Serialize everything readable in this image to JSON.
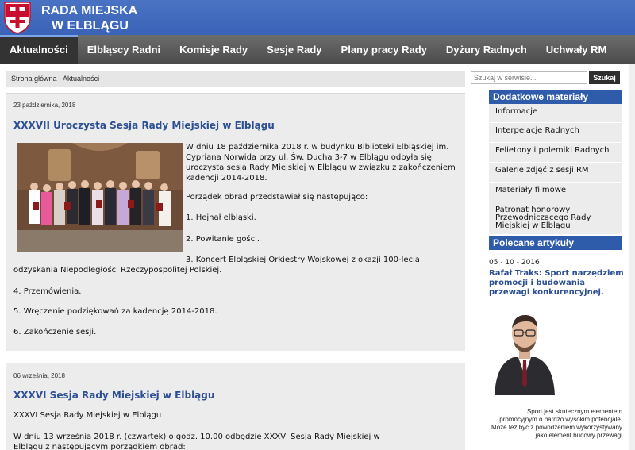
{
  "site": {
    "title_line1": "RADA MIEJSKA",
    "title_line2": "W ELBLĄGU"
  },
  "nav": [
    {
      "label": "Aktualności",
      "active": true
    },
    {
      "label": "Elbląscy Radni"
    },
    {
      "label": "Komisje Rady"
    },
    {
      "label": "Sesje Rady"
    },
    {
      "label": "Plany pracy Rady"
    },
    {
      "label": "Dyżury Radnych"
    },
    {
      "label": "Uchwały RM"
    }
  ],
  "breadcrumb": "Strona główna - Aktualności",
  "search": {
    "placeholder": "Szukaj w serwisie...",
    "button": "Szukaj"
  },
  "articles": [
    {
      "date": "23 października, 2018",
      "title": "XXXVII Uroczysta Sesja Rady Miejskiej w Elblągu",
      "intro": "W dniu 18 października 2018 r. w budynku Biblioteki Elbląskiej im. Cypriana Norwida przy ul. Św. Ducha 3-7 w Elblągu odbyła się uroczysta sesja Rady Miejskiej w Elblągu w związku z zakończeniem kadencji 2014-2018.",
      "agenda_intro": "Porządek obrad przedstawiał się następująco:",
      "items": [
        "1. Hejnał elbląski.",
        "2. Powitanie gości.",
        "3. Koncert Elbląskiej Orkiestry Wojskowej z okazji 100-lecia odzyskania Niepodległości Rzeczypospolitej Polskiej.",
        "4. Przemówienia.",
        "5. Wręczenie podziękowań za kadencję 2014-2018.",
        "6. Zakończenie sesji."
      ]
    },
    {
      "date": "06 września, 2018",
      "title": "XXXVI Sesja Rady Miejskiej w Elblągu",
      "subtitle": "XXXVI Sesja Rady Miejskiej w Elblągu",
      "text": "W dniu 13 września 2018 r. (czwartek) o godz. 10.00 odbędzie XXXVI Sesja Rady Miejskiej w Elblągu z następującym porządkiem obrad:"
    }
  ],
  "sidebar": {
    "materials_title": "Dodatkowe materiały",
    "materials": [
      "Informacje",
      "Interpelacje Radnych",
      "Felietony i polemiki Radnych",
      "Galerie zdjęć z sesji RM",
      "Materiały filmowe",
      "Patronat honorowy Przewodniczącego Rady Miejskiej w Elblągu"
    ],
    "recommended_title": "Polecane artykuły",
    "recommended": {
      "date": "05 - 10 - 2016",
      "title": "Rafał Traks: Sport narzędziem promocji i budowania przewagi konkurencyjnej.",
      "text": "Sport jest skutecznym elementem promocyjnym o bardzo wysokim potencjale. Może też być z powodzeniem wykorzystywany jako element budowy przewagi"
    }
  },
  "colors": {
    "header": "#3f68bd",
    "nav": "#575757",
    "accent": "#2f5bab",
    "link": "#2c4f94"
  }
}
